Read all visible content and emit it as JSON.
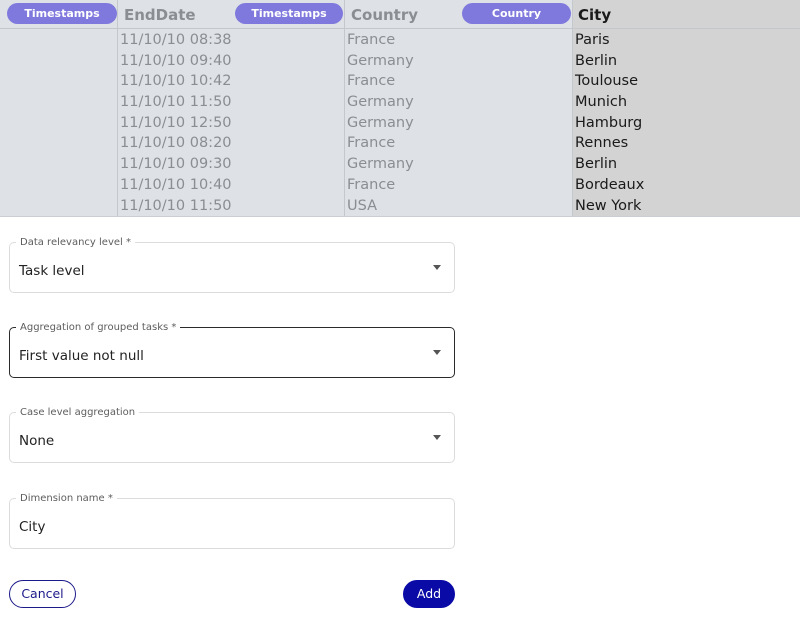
{
  "table": {
    "columns": [
      {
        "pill": "Timestamps",
        "title": ""
      },
      {
        "pill": "Timestamps",
        "title": "EndDate"
      },
      {
        "pill": "Country",
        "title": "Country"
      },
      {
        "pill": "",
        "title": "City"
      }
    ],
    "end_dates": [
      "11/10/10 08:38",
      "11/10/10 09:40",
      "11/10/10 10:42",
      "11/10/10 11:50",
      "11/10/10 12:50",
      "11/10/10 08:20",
      "11/10/10 09:30",
      "11/10/10 10:40",
      "11/10/10 11:50"
    ],
    "countries": [
      "France",
      "Germany",
      "France",
      "Germany",
      "Germany",
      "France",
      "Germany",
      "France",
      "USA"
    ],
    "cities": [
      "Paris",
      "Berlin",
      "Toulouse",
      "Munich",
      "Hamburg",
      "Rennes",
      "Berlin",
      "Bordeaux",
      "New York"
    ]
  },
  "form": {
    "relevancy": {
      "label": "Data relevancy level *",
      "value": "Task level"
    },
    "aggregation": {
      "label": "Aggregation of grouped tasks *",
      "value": "First value not null"
    },
    "case_aggregation": {
      "label": "Case level aggregation",
      "value": "None"
    },
    "dimension_name": {
      "label": "Dimension name *",
      "value": "City"
    }
  },
  "actions": {
    "cancel_label": "Cancel",
    "add_label": "Add"
  },
  "colors": {
    "pill": "#8079dd",
    "primary": "#0a0aa6",
    "table_bg": "#dee1e5",
    "selected_col_bg": "#d3d3d3"
  }
}
